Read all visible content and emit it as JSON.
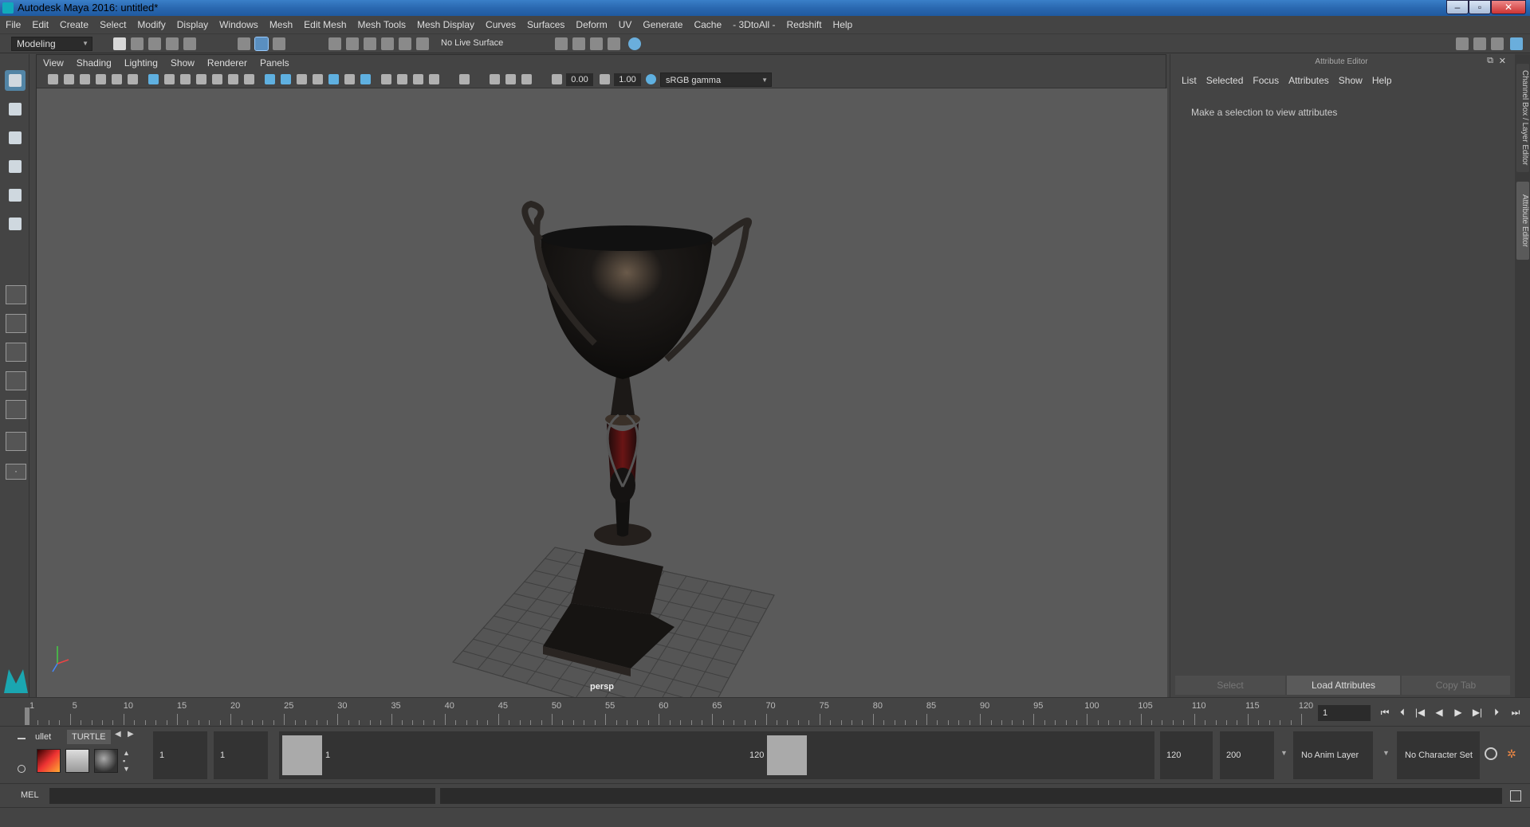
{
  "window": {
    "title": "Autodesk Maya 2016: untitled*"
  },
  "menu": [
    "File",
    "Edit",
    "Create",
    "Select",
    "Modify",
    "Display",
    "Windows",
    "Mesh",
    "Edit Mesh",
    "Mesh Tools",
    "Mesh Display",
    "Curves",
    "Surfaces",
    "Deform",
    "UV",
    "Generate",
    "Cache",
    "- 3DtoAll -",
    "Redshift",
    "Help"
  ],
  "status_line": {
    "mode": "Modeling",
    "live_surface": "No Live Surface"
  },
  "viewport": {
    "menu": [
      "View",
      "Shading",
      "Lighting",
      "Show",
      "Renderer",
      "Panels"
    ],
    "exposure": "0.00",
    "gamma_value": "1.00",
    "color_space": "sRGB gamma",
    "camera_label": "persp"
  },
  "attribute_editor": {
    "title": "Attribute Editor",
    "menu": [
      "List",
      "Selected",
      "Focus",
      "Attributes",
      "Show",
      "Help"
    ],
    "message": "Make a selection to view attributes",
    "buttons": {
      "select": "Select",
      "load": "Load Attributes",
      "copy": "Copy Tab"
    }
  },
  "side_tabs": {
    "channel_box": "Channel Box / Layer Editor",
    "attribute_editor": "Attribute Editor"
  },
  "time_slider": {
    "ticks": [
      "1",
      "5",
      "10",
      "15",
      "20",
      "25",
      "30",
      "35",
      "40",
      "45",
      "50",
      "55",
      "60",
      "65",
      "70",
      "75",
      "80",
      "85",
      "90",
      "95",
      "100",
      "105",
      "110",
      "115",
      "120"
    ],
    "current_frame": "1",
    "playback": {
      "first": "⏮",
      "prev_key": "⏴",
      "step_back": "|◀",
      "play_back": "◀",
      "play": "▶",
      "step_fwd": "▶|",
      "next_key": "⏵",
      "last": "⏭"
    }
  },
  "range_slider": {
    "shelf_tabs": [
      "ullet",
      "TURTLE"
    ],
    "start_frame": "1",
    "playback_start": "1",
    "range_start_label": "1",
    "range_end_label": "120",
    "playback_end": "120",
    "end_frame": "200",
    "anim_layer": "No Anim Layer",
    "character_set": "No Character Set"
  },
  "command_line": {
    "label": "MEL"
  }
}
